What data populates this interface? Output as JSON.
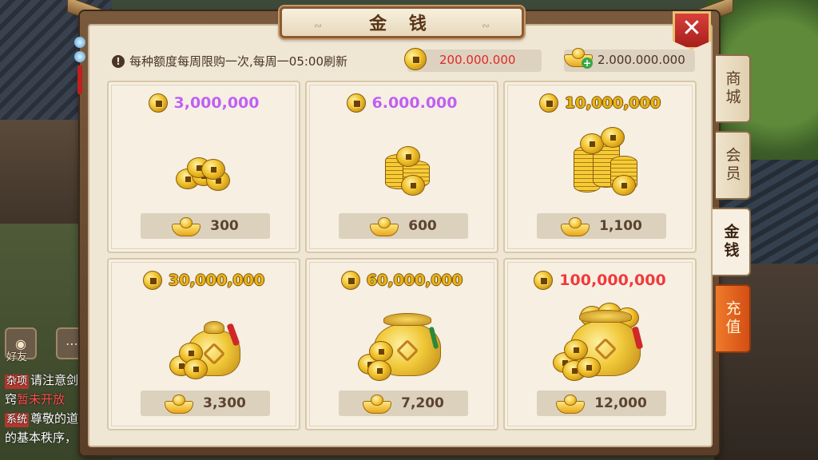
{
  "panel": {
    "title": "金 钱",
    "notice": "每种额度每周限购一次,每周一05:00刷新",
    "coin_balance": "200.000.000",
    "ingot_balance": "2.000.000.000"
  },
  "items": [
    {
      "amount": "3,000,000",
      "cost": "300",
      "amount_color": "purple",
      "art": "small-coin-pile"
    },
    {
      "amount": "6.000.000",
      "cost": "600",
      "amount_color": "purple",
      "art": "coin-stacks"
    },
    {
      "amount": "10,000,000",
      "cost": "1,100",
      "amount_color": "gold",
      "art": "tall-coin-stacks"
    },
    {
      "amount": "30,000,000",
      "cost": "3,300",
      "amount_color": "gold",
      "art": "small-money-bag"
    },
    {
      "amount": "60,000,000",
      "cost": "7,200",
      "amount_color": "gold",
      "art": "money-bag"
    },
    {
      "amount": "100,000,000",
      "cost": "12,000",
      "amount_color": "red",
      "art": "large-money-bag"
    }
  ],
  "tabs": [
    {
      "label": "商城",
      "active": false
    },
    {
      "label": "会员",
      "active": false
    },
    {
      "label": "金钱",
      "active": true
    },
    {
      "label": "充值",
      "active": false
    }
  ],
  "chat": {
    "friends_label": "好友",
    "lines": [
      {
        "tag": "杂项",
        "text": "请注意剑"
      },
      {
        "tag": "",
        "text": "窍",
        "warn": "暂未开放"
      },
      {
        "tag": "系统",
        "text": "尊敬的道"
      },
      {
        "tag": "",
        "text": "的基本秩序，"
      }
    ]
  },
  "colors": {
    "purple": "#c060f0",
    "gold": "#e8b418",
    "red": "#f03a3a",
    "close": "#c02824",
    "recharge_tab": "#e0601e"
  },
  "icons": {
    "coin": "gold-coin-icon",
    "ingot": "gold-ingot-icon",
    "close": "close-icon",
    "notice": "info-icon"
  }
}
